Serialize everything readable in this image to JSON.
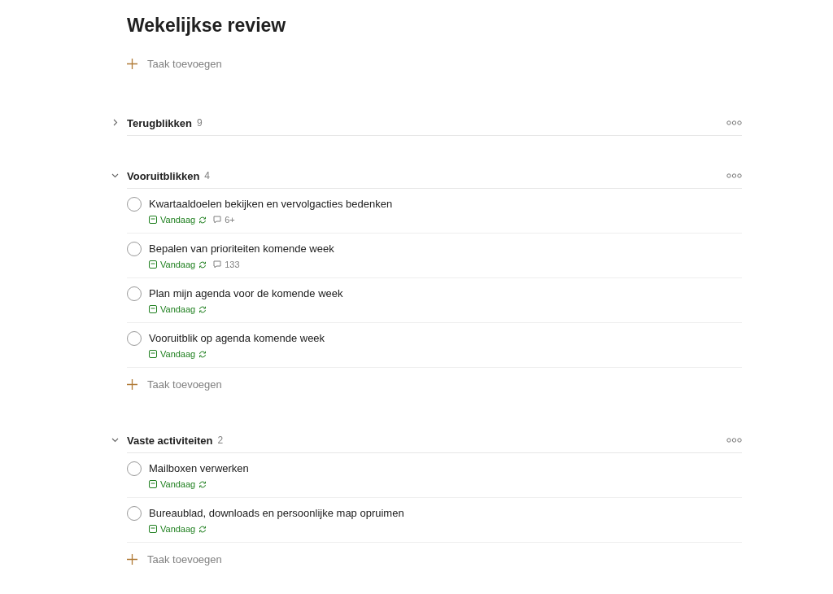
{
  "title": "Wekelijkse review",
  "add_task": "Taak toevoegen",
  "sections": [
    {
      "name": "Terugblikken",
      "count": "9",
      "expanded": false
    },
    {
      "name": "Vooruitblikken",
      "count": "4",
      "expanded": true,
      "add_task": "Taak toevoegen",
      "tasks": [
        {
          "title": "Kwartaaldoelen bekijken en vervolgacties bedenken",
          "checked": false,
          "due": "Vandaag",
          "recurring": true,
          "comments": "6+"
        },
        {
          "title": "Bepalen van prioriteiten komende week",
          "checked": false,
          "due": "Vandaag",
          "recurring": true,
          "comments": "133"
        },
        {
          "title": "Plan mijn agenda voor de komende week",
          "checked": false,
          "due": "Vandaag",
          "recurring": true
        },
        {
          "title": "Vooruitblik op agenda komende week",
          "checked": false,
          "due": "Vandaag",
          "recurring": true
        }
      ]
    },
    {
      "name": "Vaste activiteiten",
      "count": "2",
      "expanded": true,
      "add_task": "Taak toevoegen",
      "tasks": [
        {
          "title": "Mailboxen verwerken",
          "checked": false,
          "due": "Vandaag",
          "recurring": true
        },
        {
          "title": "Bureaublad, downloads en persoonlijke map opruimen",
          "checked": false,
          "due": "Vandaag",
          "recurring": true
        }
      ]
    }
  ]
}
